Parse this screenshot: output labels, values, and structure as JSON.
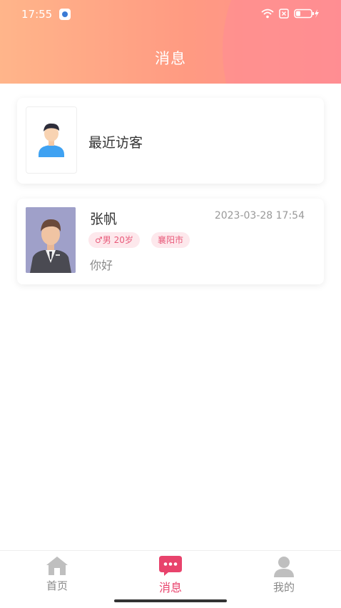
{
  "status_bar": {
    "time": "17:55"
  },
  "header": {
    "title": "消息"
  },
  "visitors_card": {
    "label": "最近访客"
  },
  "chat": {
    "name": "张帆",
    "time": "2023-03-28 17:54",
    "gender_tag": "♂男  20岁",
    "city_tag": "襄阳市",
    "message": "你好"
  },
  "nav": {
    "items": [
      {
        "label": "首页",
        "icon": "home-icon"
      },
      {
        "label": "消息",
        "icon": "chat-bubble-icon"
      },
      {
        "label": "我的",
        "icon": "person-icon"
      }
    ]
  },
  "colors": {
    "accent": "#e8436c",
    "header_start": "#ffb58a",
    "header_end": "#ff8f8f",
    "tag_bg": "#fde8ec"
  }
}
